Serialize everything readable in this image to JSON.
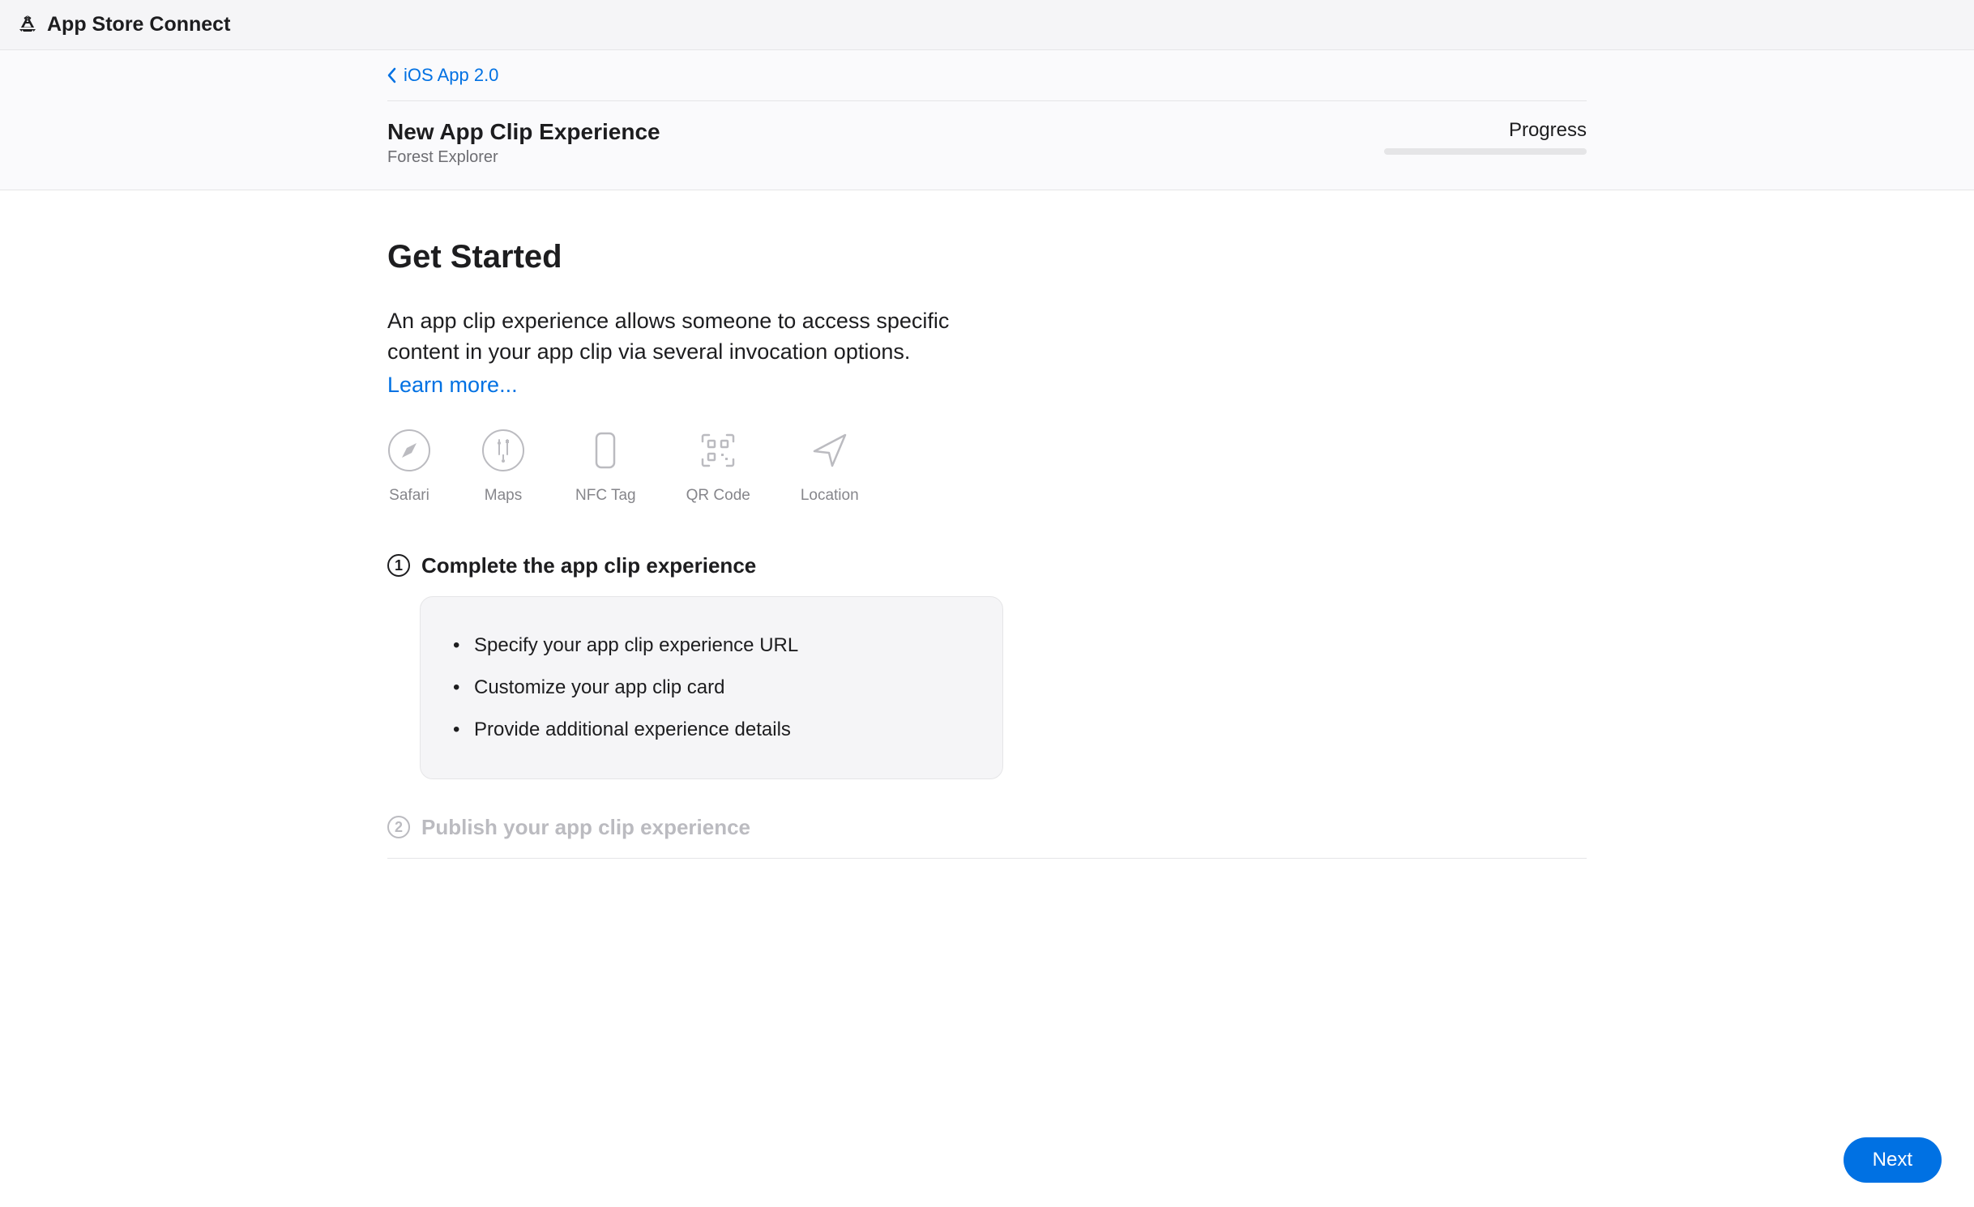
{
  "header": {
    "app_title": "App Store Connect"
  },
  "breadcrumb": {
    "back_label": "iOS App 2.0"
  },
  "page": {
    "title": "New App Clip Experience",
    "subtitle": "Forest Explorer",
    "progress_label": "Progress"
  },
  "main": {
    "heading": "Get Started",
    "intro": "An app clip experience allows someone to access specific content in your app clip via several invocation options.",
    "learn_more": "Learn more...",
    "icons": [
      {
        "name": "safari",
        "label": "Safari"
      },
      {
        "name": "maps",
        "label": "Maps"
      },
      {
        "name": "nfc",
        "label": "NFC Tag"
      },
      {
        "name": "qr",
        "label": "QR Code"
      },
      {
        "name": "location",
        "label": "Location"
      }
    ],
    "steps": [
      {
        "number": "1",
        "title": "Complete the app clip experience",
        "active": true,
        "bullets": [
          "Specify your app clip experience URL",
          "Customize your app clip card",
          "Provide additional experience details"
        ]
      },
      {
        "number": "2",
        "title": "Publish your app clip experience",
        "active": false
      }
    ]
  },
  "footer": {
    "next_label": "Next"
  }
}
